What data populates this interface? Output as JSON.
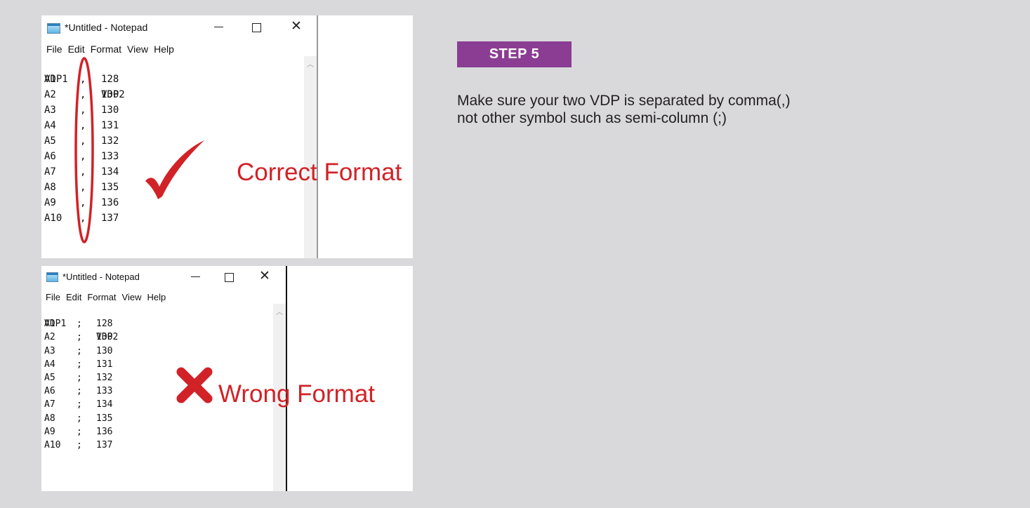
{
  "step_label": "STEP 5",
  "instructions": [
    "Make sure your two VDP is separated by comma(,)",
    "not other symbol such as semi-column (;)"
  ],
  "accent_color": "#8a3d92",
  "mark_color": "#d12227",
  "examples": [
    {
      "window_title": "*Untitled - Notepad",
      "window_controls": [
        "minimize-icon",
        "maximize-icon",
        "close-icon"
      ],
      "menu": [
        "File",
        "Edit",
        "Format",
        "View",
        "Help"
      ],
      "header": [
        "VDP1",
        "",
        "VDP2"
      ],
      "rows": [
        [
          "A1",
          ",",
          "128"
        ],
        [
          "A2",
          ",",
          "130"
        ],
        [
          "A3",
          ",",
          "130"
        ],
        [
          "A4",
          ",",
          "131"
        ],
        [
          "A5",
          ",",
          "132"
        ],
        [
          "A6",
          ",",
          "133"
        ],
        [
          "A7",
          ",",
          "134"
        ],
        [
          "A8",
          ",",
          "135"
        ],
        [
          "A9",
          ",",
          "136"
        ],
        [
          "A10",
          ",",
          "137"
        ]
      ],
      "verdict": "Correct Format",
      "verdict_icon": "check-mark-icon"
    },
    {
      "window_title": "*Untitled - Notepad",
      "window_controls": [
        "minimize-icon",
        "maximize-icon",
        "close-icon"
      ],
      "menu": [
        "File",
        "Edit",
        "Format",
        "View",
        "Help"
      ],
      "header": [
        "VDP1",
        "",
        "VDP2"
      ],
      "rows": [
        [
          "A1",
          ";",
          "128"
        ],
        [
          "A2",
          ";",
          "130"
        ],
        [
          "A3",
          ";",
          "130"
        ],
        [
          "A4",
          ";",
          "131"
        ],
        [
          "A5",
          ";",
          "132"
        ],
        [
          "A6",
          ";",
          "133"
        ],
        [
          "A7",
          ";",
          "134"
        ],
        [
          "A8",
          ";",
          "135"
        ],
        [
          "A9",
          ";",
          "136"
        ],
        [
          "A10",
          ";",
          "137"
        ]
      ],
      "verdict": "Wrong Format",
      "verdict_icon": "cross-mark-icon"
    }
  ]
}
